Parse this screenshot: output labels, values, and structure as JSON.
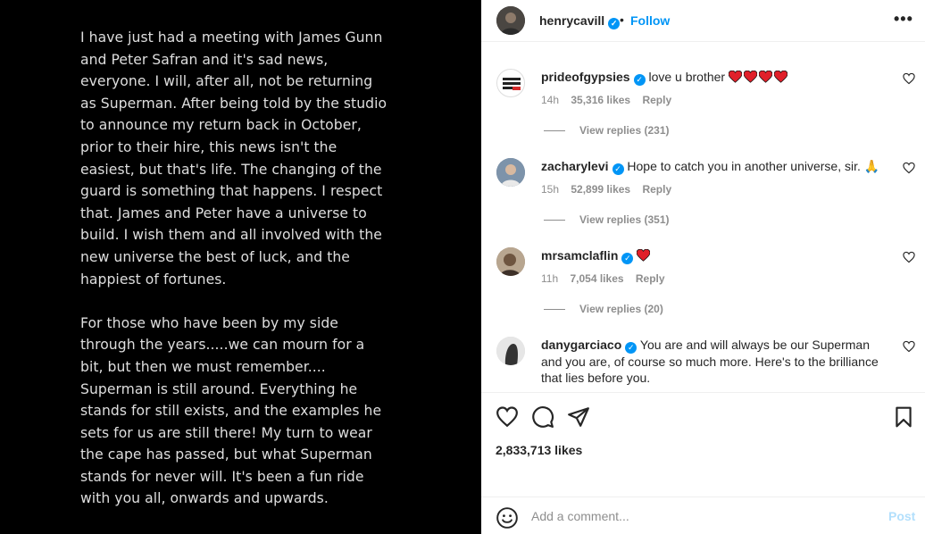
{
  "post_image": {
    "paragraphs": [
      "I have just had a meeting with James Gunn and Peter Safran and it's sad news, everyone. I will, after all, not be returning as Superman. After being told by the studio to announce my return back in October, prior to their hire, this news isn't the easiest, but that's life. The changing of the guard is something that happens. I respect that. James and Peter have a universe to build. I wish them and all involved with the new universe the best of luck, and the happiest of fortunes.",
      "For those who have been by my side through the years.....we can mourn for a bit, but then we must remember.... Superman is still around. Everything he stands for still exists, and the examples he sets for us are still there! My turn to wear the cape has passed, but what Superman stands for never will. It's been a fun ride with you all, onwards and upwards."
    ]
  },
  "header": {
    "username": "henrycavill",
    "separator": "•",
    "follow_label": "Follow",
    "more_label": "•••"
  },
  "comments": [
    {
      "username": "prideofgypsies",
      "text": "love u brother",
      "time": "14h",
      "likes": "35,316 likes",
      "reply_label": "Reply",
      "view_replies": "View replies (231)"
    },
    {
      "username": "zacharylevi",
      "text": "Hope to catch you in another universe, sir. 🙏",
      "time": "15h",
      "likes": "52,899 likes",
      "reply_label": "Reply",
      "view_replies": "View replies (351)"
    },
    {
      "username": "mrsamclaflin",
      "text": "",
      "time": "11h",
      "likes": "7,054 likes",
      "reply_label": "Reply",
      "view_replies": "View replies (20)"
    },
    {
      "username": "danygarciaco",
      "text": "You are and will always be our Superman and you are, of course so much more. Here's to the brilliance that lies before you."
    }
  ],
  "post_likes": "2,833,713 likes",
  "add_comment": {
    "placeholder": "Add a comment...",
    "post_label": "Post"
  },
  "colors": {
    "accent": "#0095f6",
    "heart": "#ed4956",
    "muted": "#8e8e8e"
  }
}
